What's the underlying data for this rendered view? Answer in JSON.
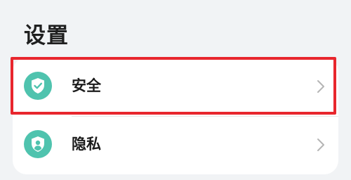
{
  "header": {
    "title": "设置"
  },
  "settings": {
    "items": [
      {
        "label": "安全",
        "icon": "shield-check-icon"
      },
      {
        "label": "隐私",
        "icon": "shield-person-icon"
      }
    ]
  },
  "colors": {
    "icon_bg": "#4fc3ae",
    "highlight": "#e8262d",
    "background": "#f1f3f5"
  }
}
